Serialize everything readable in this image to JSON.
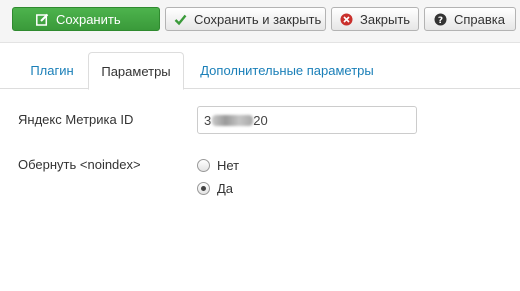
{
  "toolbar": {
    "save_label": "Сохранить",
    "save_close_label": "Сохранить и закрыть",
    "close_label": "Закрыть",
    "help_label": "Справка"
  },
  "tabs": [
    {
      "label": "Плагин",
      "active": false
    },
    {
      "label": "Параметры",
      "active": true
    },
    {
      "label": "Дополнительные параметры",
      "active": false
    }
  ],
  "form": {
    "metrika": {
      "label": "Яндекс Метрика ID",
      "value_prefix": "3",
      "value_suffix": "20"
    },
    "noindex": {
      "label": "Обернуть <noindex>",
      "options": [
        {
          "label": "Нет",
          "selected": false
        },
        {
          "label": "Да",
          "selected": true
        }
      ]
    }
  },
  "colors": {
    "primary_green": "#46a546",
    "link_blue": "#1a7fb8",
    "close_red": "#c9302c"
  },
  "icons": {
    "save": "edit-icon",
    "save_close": "check-icon",
    "close": "cancel-circle-icon",
    "help": "question-circle-icon"
  }
}
